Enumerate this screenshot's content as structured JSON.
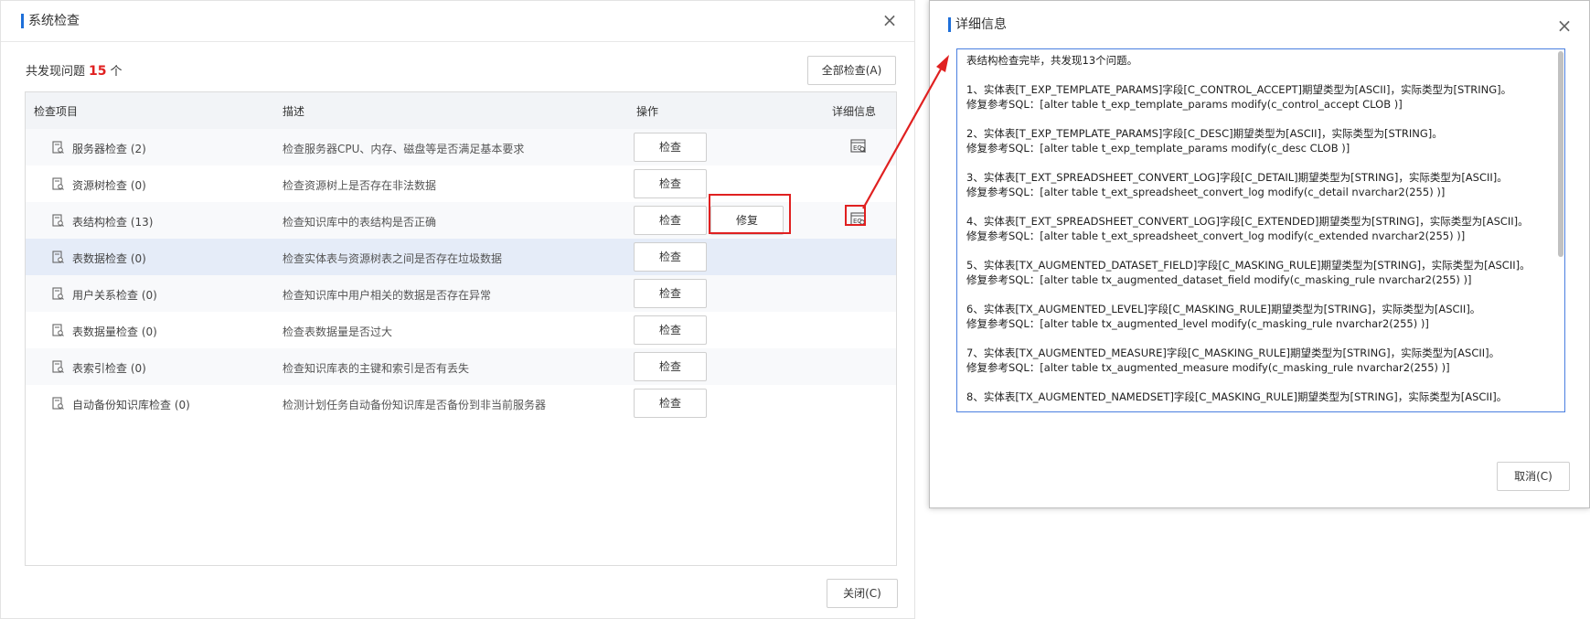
{
  "left_dialog": {
    "title": "系统检查",
    "close_glyph": "×",
    "summary_prefix": "共发现问题",
    "summary_count": "15",
    "summary_suffix": "个",
    "check_all_label": "全部检查(A)",
    "close_button_label": "关闭(C)",
    "columns": [
      "检查项目",
      "描述",
      "操作",
      "详细信息"
    ],
    "rows": [
      {
        "name": "服务器检查 (2)",
        "desc": "检查服务器CPU、内存、磁盘等是否满足基本要求",
        "check": "检查",
        "has_detail": true
      },
      {
        "name": "资源树检查 (0)",
        "desc": "检查资源树上是否存在非法数据",
        "check": "检查"
      },
      {
        "name": "表结构检查 (13)",
        "desc": "检查知识库中的表结构是否正确",
        "check": "检查",
        "fix": "修复",
        "has_detail": true
      },
      {
        "name": "表数据检查 (0)",
        "desc": "检查实体表与资源树表之间是否存在垃圾数据",
        "check": "检查",
        "selected": true
      },
      {
        "name": "用户关系检查 (0)",
        "desc": "检查知识库中用户相关的数据是否存在异常",
        "check": "检查"
      },
      {
        "name": "表数据量检查 (0)",
        "desc": "检查表数据量是否过大",
        "check": "检查"
      },
      {
        "name": "表索引检查 (0)",
        "desc": "检查知识库表的主键和索引是否有丢失",
        "check": "检查"
      },
      {
        "name": "自动备份知识库检查 (0)",
        "desc": "检测计划任务自动备份知识库是否备份到非当前服务器",
        "check": "检查"
      }
    ],
    "highlight_color": "#e02020"
  },
  "right_dialog": {
    "title": "详细信息",
    "close_glyph": "×",
    "cancel_label": "取消(C)",
    "content": "表结构检查完毕，共发现13个问题。\n\n1、实体表[T_EXP_TEMPLATE_PARAMS]字段[C_CONTROL_ACCEPT]期望类型为[ASCII]，实际类型为[STRING]。\n修复参考SQL：[alter table t_exp_template_params modify(c_control_accept CLOB )]\n\n2、实体表[T_EXP_TEMPLATE_PARAMS]字段[C_DESC]期望类型为[ASCII]，实际类型为[STRING]。\n修复参考SQL：[alter table t_exp_template_params modify(c_desc CLOB )]\n\n3、实体表[T_EXT_SPREADSHEET_CONVERT_LOG]字段[C_DETAIL]期望类型为[STRING]，实际类型为[ASCII]。\n修复参考SQL：[alter table t_ext_spreadsheet_convert_log modify(c_detail nvarchar2(255) )]\n\n4、实体表[T_EXT_SPREADSHEET_CONVERT_LOG]字段[C_EXTENDED]期望类型为[STRING]，实际类型为[ASCII]。\n修复参考SQL：[alter table t_ext_spreadsheet_convert_log modify(c_extended nvarchar2(255) )]\n\n5、实体表[TX_AUGMENTED_DATASET_FIELD]字段[C_MASKING_RULE]期望类型为[STRING]，实际类型为[ASCII]。\n修复参考SQL：[alter table tx_augmented_dataset_field modify(c_masking_rule nvarchar2(255) )]\n\n6、实体表[TX_AUGMENTED_LEVEL]字段[C_MASKING_RULE]期望类型为[STRING]，实际类型为[ASCII]。\n修复参考SQL：[alter table tx_augmented_level modify(c_masking_rule nvarchar2(255) )]\n\n7、实体表[TX_AUGMENTED_MEASURE]字段[C_MASKING_RULE]期望类型为[STRING]，实际类型为[ASCII]。\n修复参考SQL：[alter table tx_augmented_measure modify(c_masking_rule nvarchar2(255) )]\n\n8、实体表[TX_AUGMENTED_NAMEDSET]字段[C_MASKING_RULE]期望类型为[STRING]，实际类型为[ASCII]。"
  }
}
